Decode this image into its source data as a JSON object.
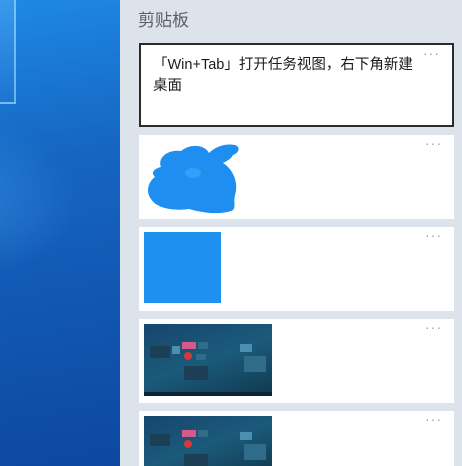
{
  "panel": {
    "title": "剪贴板"
  },
  "items": [
    {
      "type": "text",
      "text": "「Win+Tab」打开任务视图，右下角新建桌面",
      "more_label": "···"
    },
    {
      "type": "image",
      "icon": "blue-blob-image",
      "more_label": "···"
    },
    {
      "type": "image",
      "icon": "blue-square-image",
      "more_label": "···"
    },
    {
      "type": "image",
      "icon": "task-view-screenshot",
      "more_label": "···"
    },
    {
      "type": "image",
      "icon": "task-view-screenshot",
      "more_label": "···"
    }
  ],
  "colors": {
    "panel_bg": "#dde3ea",
    "card_bg": "#ffffff",
    "selection_border": "#2b2b2b",
    "image_blue": "#1e90f0"
  }
}
